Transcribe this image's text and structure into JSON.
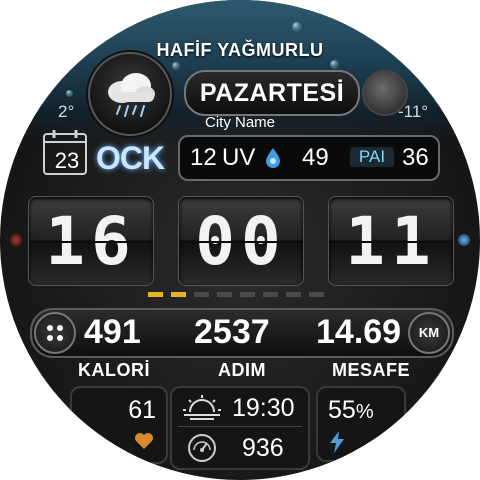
{
  "weather": {
    "condition": "HAFİF YAĞMURLU",
    "low_temp": "2°",
    "high_temp": "-11°",
    "icon": "rain-cloud-icon"
  },
  "day": "PAZARTESİ",
  "city": "City Name",
  "date": {
    "day": "23",
    "month": "OCK"
  },
  "info": {
    "uv_value": "12",
    "uv_label": "UV",
    "humidity": "49",
    "pai_label": "PAI",
    "pai_value": "36"
  },
  "time": {
    "hours": "16",
    "minutes": "00",
    "seconds": "11"
  },
  "progress": {
    "active_segments": 2,
    "total_segments": 8,
    "active_color": "#e6b422",
    "inactive_color": "#4a4a4a"
  },
  "stats": {
    "calories": "491",
    "steps": "2537",
    "distance": "14.69",
    "distance_unit": "KM"
  },
  "labels": {
    "calories": "KALORİ",
    "steps": "ADIM",
    "distance": "MESAFE"
  },
  "panels": {
    "heart_value": "61",
    "sunrise_time": "19:30",
    "pressure_value": "936",
    "battery_value": "55",
    "battery_unit": "%"
  },
  "colors": {
    "accent_blue": "#6ab4ff",
    "heart": "#d98a2b",
    "bolt": "#4a9fd8"
  }
}
